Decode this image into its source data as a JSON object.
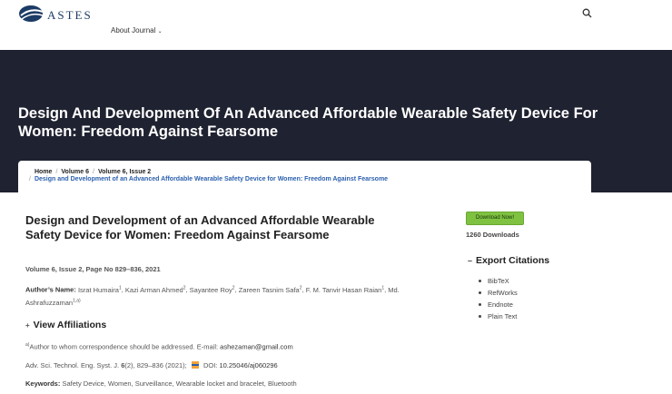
{
  "header": {
    "logo_text": "ASTES",
    "nav_about": "About Journal",
    "nav_about_chevron": "⌄"
  },
  "hero": {
    "title": "Design And Development Of An Advanced Affordable Wearable Safety Device For Women: Freedom Against Fearsome"
  },
  "breadcrumb": {
    "home": "Home",
    "volume": "Volume 6",
    "issue": "Volume 6, Issue 2",
    "current": "Design and Development of an Advanced Affordable Wearable Safety Device for Women: Freedom Against Fearsome",
    "sep": "/"
  },
  "article": {
    "title": "Design and Development of an Advanced Affordable Wearable Safety Device for Women: Freedom Against Fearsome",
    "volume_info": "Volume 6, Issue 2, Page No 829–836, 2021",
    "authors_label": "Author’s Name:",
    "authors": [
      {
        "name": "Israt Humaira",
        "sup": "1",
        "sep": ", "
      },
      {
        "name": "Kazi Arman Ahmed",
        "sup": "2",
        "sep": ", "
      },
      {
        "name": "Sayantee Roy",
        "sup": "2",
        "sep": ", "
      },
      {
        "name": "Zareen Tasnim Safa",
        "sup": "2",
        "sep": ", "
      },
      {
        "name": "F. M. Tanvir Hasan Raian",
        "sup": "1",
        "sep": ", "
      },
      {
        "name": "Md. Ashrafuzzaman",
        "sup": "1,a)",
        "sep": ""
      }
    ],
    "affiliations_label": "View Affiliations",
    "affiliations_toggle": "+",
    "corr_sup": "a)",
    "corr_text": "Author to whom correspondence should be addressed. E-mail: ",
    "corr_email": "ashezaman@gmail.com",
    "cite_journal": "Adv. Sci. Technol. Eng. Syst. J. ",
    "cite_volume": "6",
    "cite_rest": "(2), 829–836 (2021);",
    "cite_doi_label": "DOI: ",
    "cite_doi": "10.25046/aj060296",
    "keywords_label": "Keywords:",
    "keywords": "Safety Device, Women, Surveillance, Wearable locket and bracelet, Bluetooth"
  },
  "sidebar": {
    "download_button": "Download Now!",
    "downloads_count": "1260 Downloads",
    "export_toggle": "–",
    "export_title": "Export Citations",
    "export_items": [
      "BibTeX",
      "RefWorks",
      "Endnote",
      "Plain Text"
    ]
  },
  "colors": {
    "hero_bg": "#1f2230",
    "link_blue": "#2a5fae",
    "download_green": "#7fc241",
    "logo_navy": "#1c3b66"
  },
  "icons": {
    "search": "search-icon",
    "logo": "astes-logo-icon",
    "doi": "doi-icon"
  }
}
